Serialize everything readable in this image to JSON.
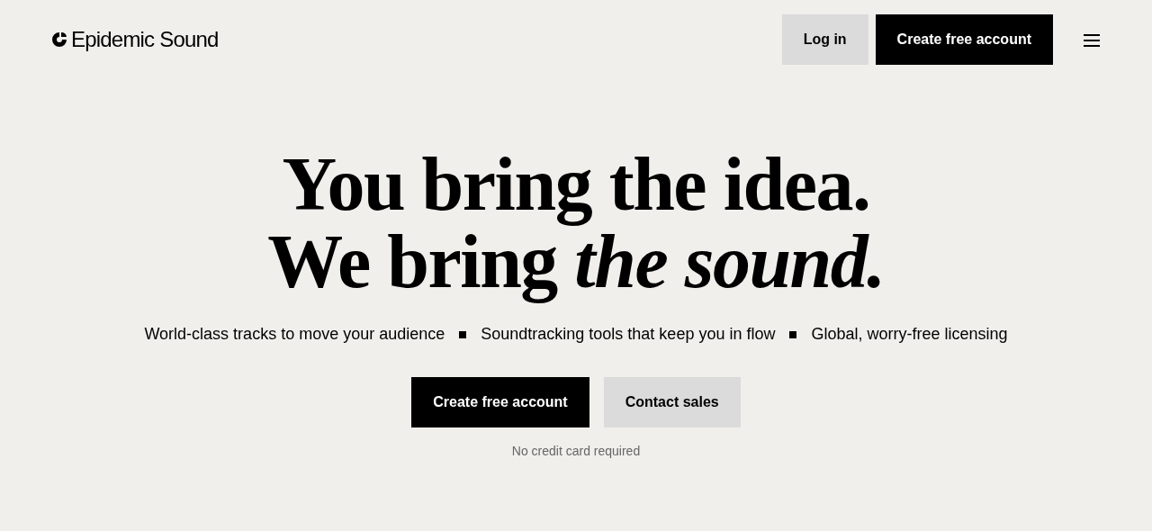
{
  "header": {
    "logo_text": "Epidemic Sound",
    "buttons": [
      {
        "label": "Log in",
        "kind": "secondary"
      },
      {
        "label": "Create free account",
        "kind": "primary"
      }
    ]
  },
  "hero": {
    "headline": [
      "You bring the idea.",
      "We bring *the sound.*"
    ],
    "features": [
      "World-class tracks to move your audience",
      "Soundtracking tools that keep you in flow",
      "Global, worry-free licensing"
    ],
    "buttons": [
      {
        "label": "Create free account",
        "kind": "primary"
      },
      {
        "label": "Contact sales",
        "kind": "secondary"
      }
    ],
    "note": "No credit card required"
  }
}
